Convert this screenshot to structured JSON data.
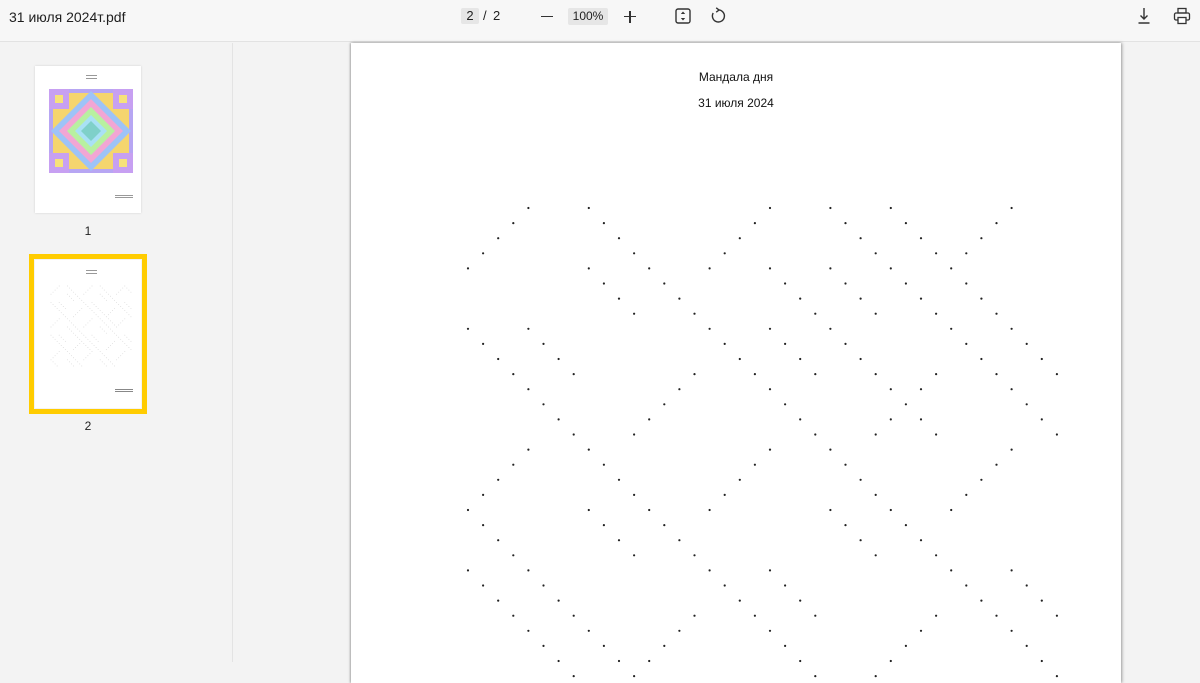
{
  "toolbar": {
    "file_name": "31 июля 2024т.pdf",
    "current_page": "2",
    "page_separator": "/",
    "total_pages": "2",
    "zoom": "100%",
    "icons": [
      "zoom-out-icon",
      "zoom-in-icon",
      "fit-page-icon",
      "rotate-icon",
      "download-icon",
      "print-icon"
    ]
  },
  "sidebar": {
    "thumbnails": [
      {
        "label": "1"
      },
      {
        "label": "2",
        "selected": true
      }
    ],
    "selection_color": "#ffcc00"
  },
  "document": {
    "title": "Мандала дня",
    "date": "31 июля 2024",
    "pattern": "dot-mandala"
  }
}
